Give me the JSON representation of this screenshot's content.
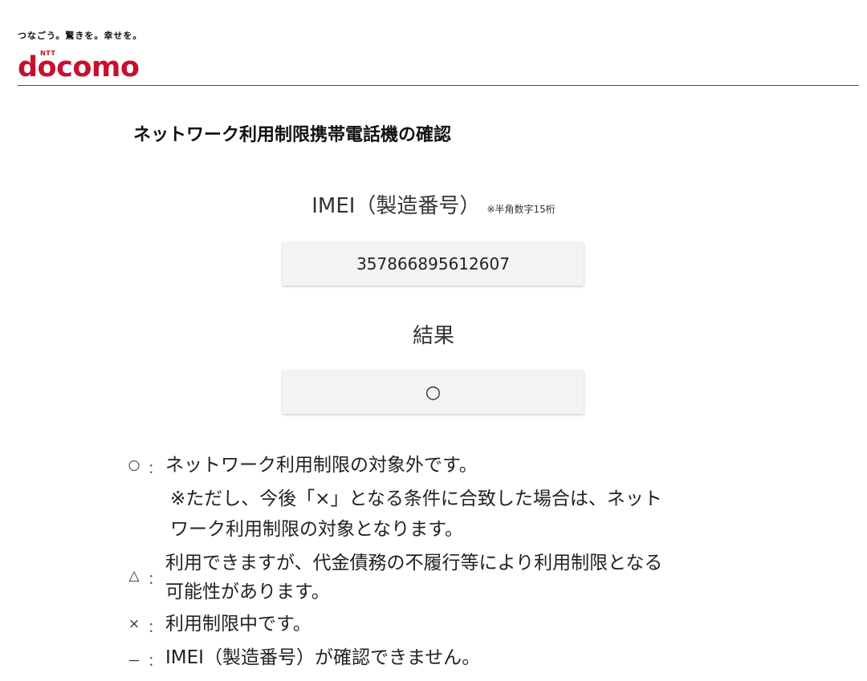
{
  "header": {
    "tagline": "つなごう。驚きを。幸せを。",
    "logo": {
      "ntt": "NTT",
      "wordmark": "docomo"
    },
    "brand_color": "#c8102e"
  },
  "page_title": "ネットワーク利用制限携帯電話機の確認",
  "imei": {
    "label": "IMEI（製造番号）",
    "note": "※半角数字15桁",
    "value": "357866895612607"
  },
  "result": {
    "label": "結果",
    "value": "○"
  },
  "legend": [
    {
      "symbol": "○",
      "colon": "：",
      "lines": [
        "ネットワーク利用制限の対象外です。"
      ],
      "sub_lines": [
        "※ただし、今後「×」となる条件に合致した場合は、ネット",
        "ワーク利用制限の対象となります。"
      ]
    },
    {
      "symbol": "△",
      "colon": "：",
      "lines": [
        "利用できますが、代金債務の不履行等により利用制限となる",
        "可能性があります。"
      ]
    },
    {
      "symbol": "×",
      "colon": "：",
      "lines": [
        "利用制限中です。"
      ]
    },
    {
      "symbol": "－",
      "colon": "：",
      "lines": [
        "IMEI（製造番号）が確認できません。"
      ]
    }
  ]
}
